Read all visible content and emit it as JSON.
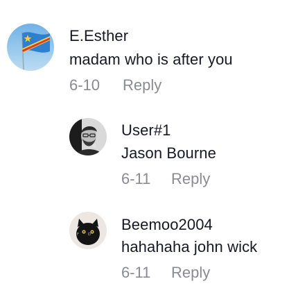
{
  "comments": [
    {
      "username": "E.Esther",
      "text": "madam who is after you",
      "date": "6-10",
      "reply_label": "Reply",
      "avatar_icon": "flag-avatar-icon"
    },
    {
      "username": "User#1",
      "text": "Jason Bourne",
      "date": "6-11",
      "reply_label": "Reply",
      "avatar_icon": "bearded-man-avatar"
    },
    {
      "username": "Beemoo2004",
      "text": "hahahaha john wick",
      "date": "6-11",
      "reply_label": "Reply",
      "avatar_icon": "black-cat-avatar"
    }
  ],
  "colors": {
    "text_primary": "#161823",
    "text_secondary": "#8a8b91",
    "background": "#ffffff"
  }
}
